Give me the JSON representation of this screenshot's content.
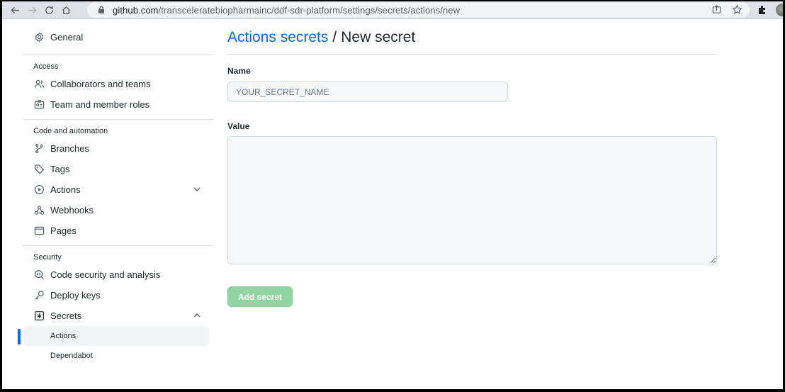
{
  "browser": {
    "url_host": "github.com",
    "url_path": "/transceleratebiopharmainc/ddf-sdr-platform/settings/secrets/actions/new"
  },
  "sidebar": {
    "general": "General",
    "sections": [
      {
        "heading": "Access",
        "items": [
          "Collaborators and teams",
          "Team and member roles"
        ]
      },
      {
        "heading": "Code and automation",
        "items": [
          "Branches",
          "Tags",
          "Actions",
          "Webhooks",
          "Pages"
        ]
      },
      {
        "heading": "Security",
        "items": [
          "Code security and analysis",
          "Deploy keys",
          "Secrets"
        ]
      }
    ],
    "secrets_sub": [
      "Actions",
      "Dependabot"
    ]
  },
  "main": {
    "breadcrumb": "Actions secrets",
    "separator": "/",
    "title": "New secret",
    "name_label": "Name",
    "name_placeholder": "YOUR_SECRET_NAME",
    "value_label": "Value",
    "submit_label": "Add secret"
  },
  "colors": {
    "accent": "#0969da",
    "button_disabled": "#94d3a2"
  }
}
